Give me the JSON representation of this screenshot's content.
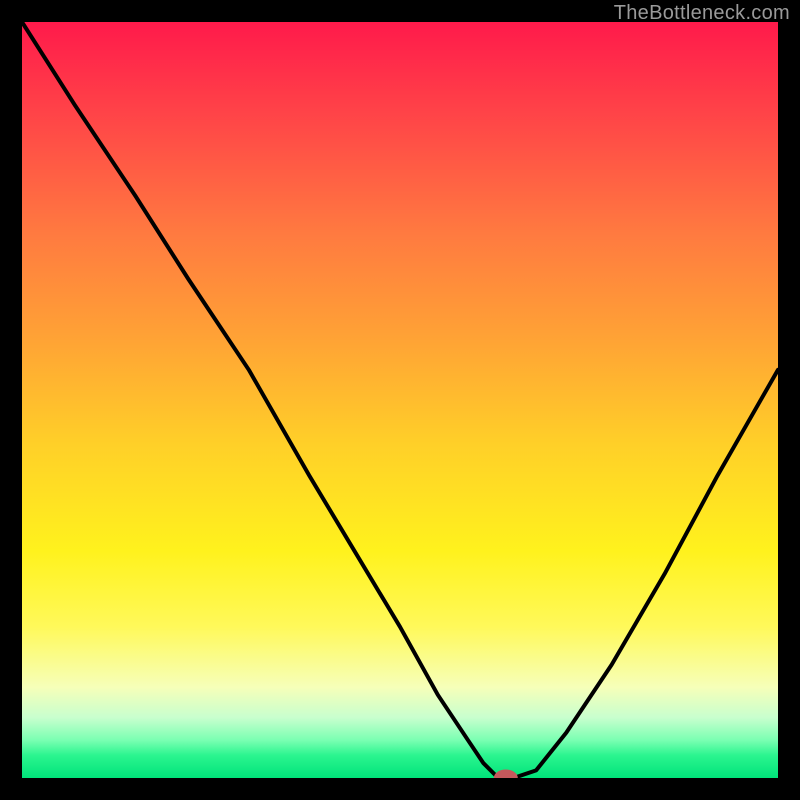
{
  "attribution": "TheBottleneck.com",
  "chart_data": {
    "type": "line",
    "title": "",
    "xlabel": "",
    "ylabel": "",
    "xlim": [
      0,
      100
    ],
    "ylim": [
      0,
      100
    ],
    "x": [
      0,
      7,
      15,
      22,
      30,
      38,
      44,
      50,
      55,
      59,
      61,
      63,
      65,
      68,
      72,
      78,
      85,
      92,
      100
    ],
    "values": [
      100,
      89,
      77,
      66,
      54,
      40,
      30,
      20,
      11,
      5,
      2,
      0,
      0,
      1,
      6,
      15,
      27,
      40,
      54
    ],
    "marker": {
      "x": 64,
      "y": 0
    },
    "background_gradient": [
      "#ff1a4b",
      "#fff21d",
      "#00e37a"
    ]
  }
}
